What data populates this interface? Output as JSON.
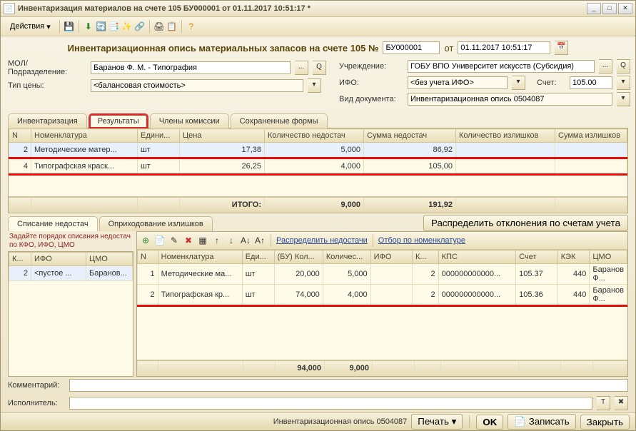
{
  "title": "Инвентаризация материалов на счете 105 БУ000001 от 01.11.2017 10:51:17 *",
  "toolbar": {
    "actions": "Действия"
  },
  "doc": {
    "heading": "Инвентаризационная опись материальных запасов на счете 105 №",
    "num": "БУ000001",
    "from": "от",
    "date": "01.11.2017 10:51:17"
  },
  "labels": {
    "mol": "МОЛ/Подразделение:",
    "priceType": "Тип цены:",
    "inst": "Учреждение:",
    "ifo": "ИФО:",
    "account": "Счет:",
    "docType": "Вид документа:",
    "comment": "Комментарий:",
    "executor": "Исполнитель:"
  },
  "values": {
    "mol": "Баранов Ф. М. - Типография",
    "priceType": "<балансовая стоимость>",
    "inst": "ГОБУ ВПО Университет искусств (Субсидия)",
    "ifo": "<без учета ИФО>",
    "account": "105.00",
    "docType": "Инвентаризационная опись 0504087"
  },
  "mainTabs": {
    "t1": "Инвентаризация",
    "t2": "Результаты",
    "t3": "Члены комиссии",
    "t4": "Сохраненные формы"
  },
  "resCols": {
    "n": "N",
    "nom": "Номенклатура",
    "unit": "Едини...",
    "price": "Цена",
    "qtyShort": "Количество недостач",
    "sumShort": "Сумма недостач",
    "qtyOver": "Количество излишков",
    "sumOver": "Сумма излишков"
  },
  "chart_data": {
    "type": "table",
    "title": "Результаты",
    "columns": [
      "N",
      "Номенклатура",
      "Едини...",
      "Цена",
      "Количество недостач",
      "Сумма недостач",
      "Количество излишков",
      "Сумма излишков"
    ],
    "rows": [
      {
        "n": "2",
        "nom": "Методические матер...",
        "unit": "шт",
        "price": "17,38",
        "qtyShort": "5,000",
        "sumShort": "86,92",
        "qtyOver": "",
        "sumOver": ""
      },
      {
        "n": "4",
        "nom": "Типографская краск...",
        "unit": "шт",
        "price": "26,25",
        "qtyShort": "4,000",
        "sumShort": "105,00",
        "qtyOver": "",
        "sumOver": ""
      }
    ],
    "totals": {
      "label": "ИТОГО:",
      "qtyShort": "9,000",
      "sumShort": "191,92"
    }
  },
  "subTabs": {
    "t1": "Списание недостач",
    "t2": "Оприходование излишков"
  },
  "distributeBtn": "Распределить отклонения по счетам учета",
  "leftHint": "Задайте порядок списания недостач по КФО, ИФО, ЦМО",
  "leftCols": {
    "k": "К...",
    "ifo": "ИФО",
    "cmo": "ЦМО"
  },
  "leftRow": {
    "k": "2",
    "ifo": "<пустое ...",
    "cmo": "Баранов..."
  },
  "miniTb": {
    "dist": "Распределить недостачи",
    "filter": "Отбор по номенклатуре"
  },
  "detCols": {
    "n": "N",
    "nom": "Номенклатура",
    "unit": "Еди...",
    "buQty": "(БУ) Кол...",
    "qty": "Количес...",
    "ifo": "ИФО",
    "k": "К...",
    "kps": "КПС",
    "acc": "Счет",
    "kek": "КЭК",
    "cmo": "ЦМО"
  },
  "detRows": [
    {
      "n": "1",
      "nom": "Методические ма...",
      "unit": "шт",
      "buQty": "20,000",
      "qty": "5,000",
      "ifo": "",
      "k": "2",
      "kps": "000000000000...",
      "acc": "105.37",
      "kek": "440",
      "cmo": "Баранов Ф..."
    },
    {
      "n": "2",
      "nom": "Типографская кр...",
      "unit": "шт",
      "buQty": "74,000",
      "qty": "4,000",
      "ifo": "",
      "k": "2",
      "kps": "000000000000...",
      "acc": "105.36",
      "kek": "440",
      "cmo": "Баранов Ф..."
    }
  ],
  "detTotals": {
    "buQty": "94,000",
    "qty": "9,000"
  },
  "status": {
    "form": "Инвентаризационная опись 0504087",
    "print": "Печать",
    "ok": "OK",
    "save": "Записать",
    "close": "Закрыть"
  },
  "icons": {
    "tx": "T",
    "x": "✖"
  }
}
